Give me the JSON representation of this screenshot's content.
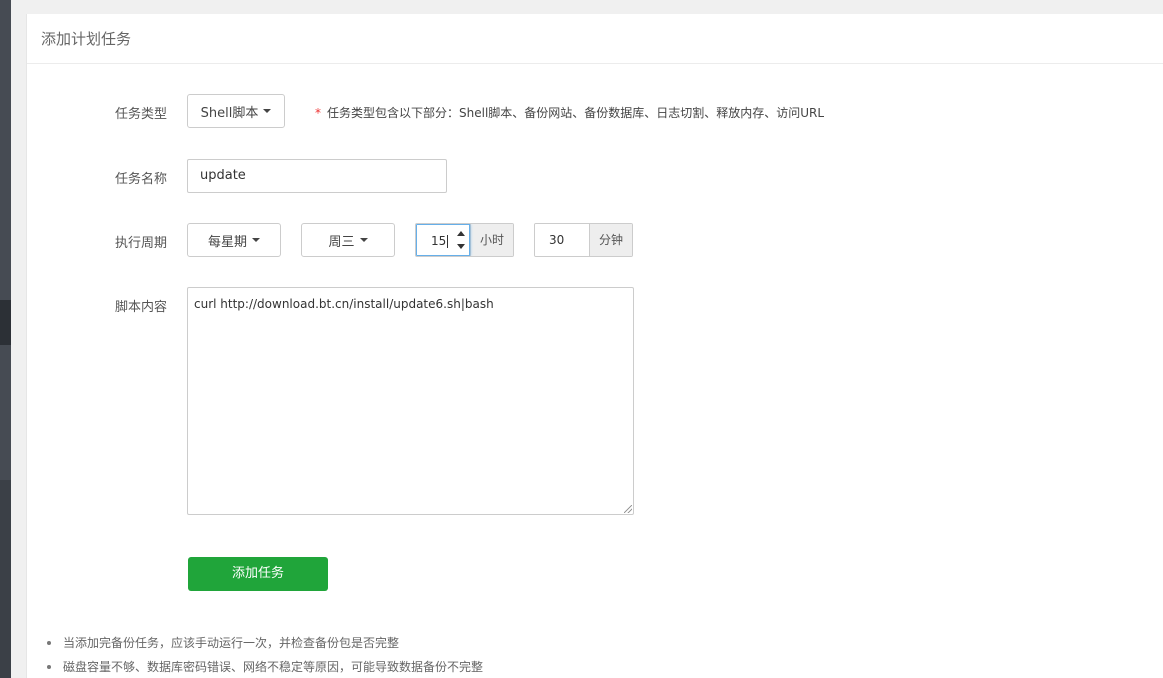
{
  "panel": {
    "title": "添加计划任务"
  },
  "form": {
    "task_type": {
      "label": "任务类型",
      "selected": "Shell脚本",
      "hint_star": "*",
      "hint": "任务类型包含以下部分：Shell脚本、备份网站、备份数据库、日志切割、释放内存、访问URL"
    },
    "task_name": {
      "label": "任务名称",
      "value": "update"
    },
    "cycle": {
      "label": "执行周期",
      "period": "每星期",
      "weekday": "周三",
      "hour": "15",
      "hour_unit": "小时",
      "minute": "30",
      "minute_unit": "分钟"
    },
    "script": {
      "label": "脚本内容",
      "value": "curl http://download.bt.cn/install/update6.sh|bash"
    },
    "submit_label": "添加任务"
  },
  "notes": [
    "当添加完备份任务，应该手动运行一次，并检查备份包是否完整",
    "磁盘容量不够、数据库密码错误、网络不稳定等原因，可能导致数据备份不完整"
  ],
  "colors": {
    "primary": "#20a53a",
    "required_star": "#e33333",
    "focus": "#66afe9"
  },
  "icons": {
    "dropdown": "caret-down-icon",
    "spinner_up": "spin-up-icon",
    "spinner_down": "spin-down-icon"
  }
}
